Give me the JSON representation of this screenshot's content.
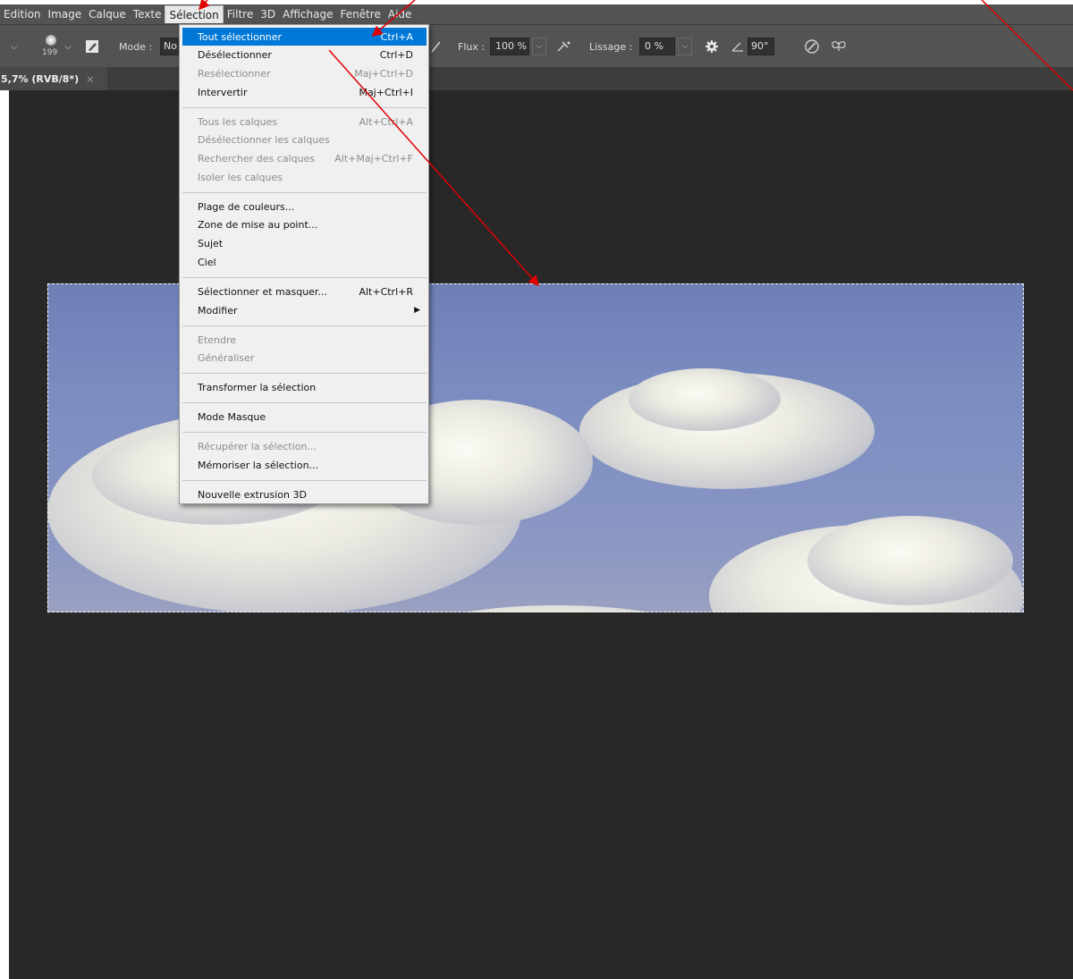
{
  "menubar": {
    "items": [
      "Edition",
      "Image",
      "Calque",
      "Texte",
      "Sélection",
      "Filtre",
      "3D",
      "Affichage",
      "Fenêtre",
      "Aide"
    ],
    "active": "Sélection"
  },
  "options": {
    "brush_size": "199",
    "mode_label": "Mode :",
    "mode_value": "No",
    "flux_label": "Flux :",
    "flux_value": "100 %",
    "lissage_label": "Lissage :",
    "lissage_value": "0 %",
    "angle_value": "90°"
  },
  "tab": {
    "title": "5,7% (RVB/8*)",
    "close": "×"
  },
  "selection_menu": {
    "groups": [
      [
        {
          "label": "Tout sélectionner",
          "shortcut": "Ctrl+A",
          "highlighted": true
        },
        {
          "label": "Désélectionner",
          "shortcut": "Ctrl+D"
        },
        {
          "label": "Resélectionner",
          "shortcut": "Maj+Ctrl+D",
          "disabled": true
        },
        {
          "label": "Intervertir",
          "shortcut": "Maj+Ctrl+I"
        }
      ],
      [
        {
          "label": "Tous les calques",
          "shortcut": "Alt+Ctrl+A",
          "disabled": true
        },
        {
          "label": "Désélectionner les calques",
          "shortcut": "",
          "disabled": true
        },
        {
          "label": "Rechercher des calques",
          "shortcut": "Alt+Maj+Ctrl+F",
          "disabled": true
        },
        {
          "label": "Isoler les calques",
          "shortcut": "",
          "disabled": true
        }
      ],
      [
        {
          "label": "Plage de couleurs...",
          "shortcut": ""
        },
        {
          "label": "Zone de mise au point...",
          "shortcut": ""
        },
        {
          "label": "Sujet",
          "shortcut": ""
        },
        {
          "label": "Ciel",
          "shortcut": ""
        }
      ],
      [
        {
          "label": "Sélectionner et masquer...",
          "shortcut": "Alt+Ctrl+R"
        },
        {
          "label": "Modifier",
          "shortcut": "",
          "submenu": true
        }
      ],
      [
        {
          "label": "Etendre",
          "shortcut": "",
          "disabled": true
        },
        {
          "label": "Généraliser",
          "shortcut": "",
          "disabled": true
        }
      ],
      [
        {
          "label": "Transformer la sélection",
          "shortcut": ""
        }
      ],
      [
        {
          "label": "Mode Masque",
          "shortcut": ""
        }
      ],
      [
        {
          "label": "Récupérer la sélection...",
          "shortcut": "",
          "disabled": true
        },
        {
          "label": "Mémoriser la sélection...",
          "shortcut": ""
        }
      ],
      [
        {
          "label": "Nouvelle extrusion 3D",
          "shortcut": ""
        }
      ]
    ]
  },
  "colors": {
    "highlight": "#0078d7",
    "annotation_arrow": "#e00000",
    "chrome": "#535353",
    "workspace": "#282828"
  }
}
